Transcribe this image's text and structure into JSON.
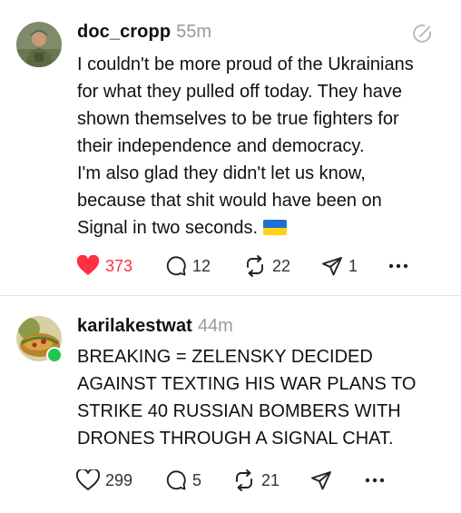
{
  "colors": {
    "like_active": "#ff3040",
    "online": "#23c552",
    "muted": "#9a9a9a"
  },
  "posts": [
    {
      "username": "doc_cropp",
      "time": "55m",
      "lines": [
        "I couldn't be more proud of the Ukrainians",
        "for what they pulled off today. They have",
        "shown themselves to be true fighters for",
        "their independence and democracy.",
        "I'm also glad they didn't let us know,",
        "because that shit would have been on",
        "Signal in two seconds."
      ],
      "flag_emoji": "ukraine-flag",
      "likes": "373",
      "liked": true,
      "replies": "12",
      "reposts": "22",
      "shares": "1"
    },
    {
      "username": "karilakestwat",
      "time": "44m",
      "online": true,
      "lines": [
        "BREAKING = ZELENSKY DECIDED",
        "AGAINST TEXTING HIS WAR PLANS TO",
        "STRIKE 40 RUSSIAN BOMBERS WITH",
        "DRONES THROUGH A SIGNAL CHAT."
      ],
      "likes": "299",
      "liked": false,
      "replies": "5",
      "reposts": "21",
      "shares": ""
    }
  ]
}
